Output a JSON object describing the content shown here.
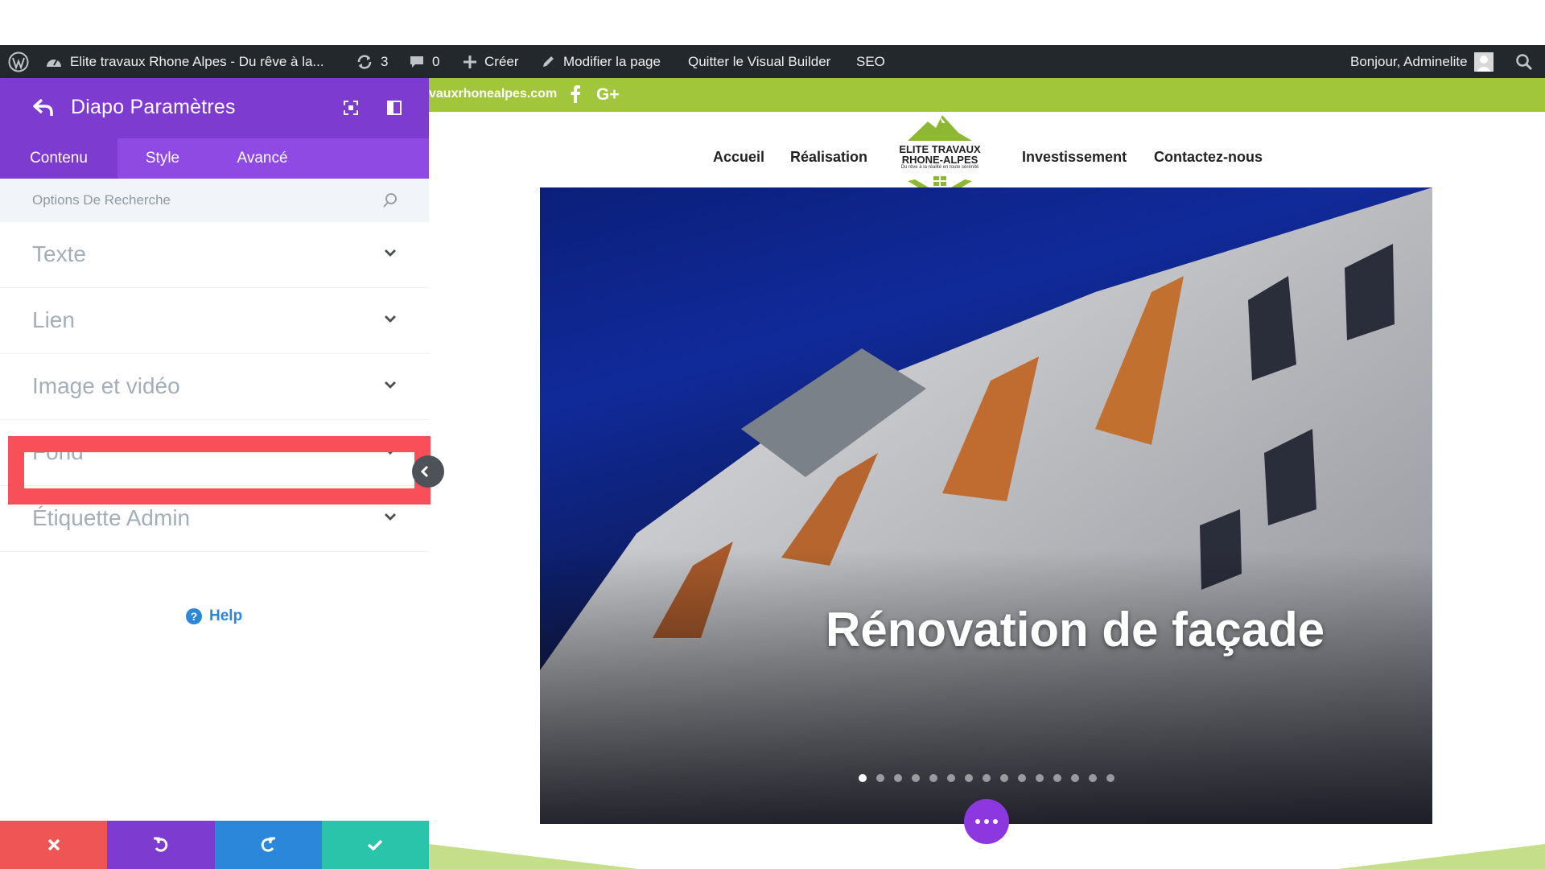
{
  "admin_bar": {
    "site_name": "Elite travaux Rhone Alpes - Du rêve à la...",
    "updates_count": "3",
    "comments_count": "0",
    "create_label": "Créer",
    "edit_page_label": "Modifier la page",
    "exit_builder_label": "Quitter le Visual Builder",
    "seo_label": "SEO",
    "greeting": "Bonjour, Adminelite"
  },
  "panel": {
    "title": "Diapo Paramètres",
    "tabs": [
      {
        "label": "Contenu",
        "active": true
      },
      {
        "label": "Style",
        "active": false
      },
      {
        "label": "Avancé",
        "active": false
      }
    ],
    "search_placeholder": "Options De Recherche",
    "toggles": [
      {
        "label": "Texte"
      },
      {
        "label": "Lien"
      },
      {
        "label": "Image et vidéo"
      },
      {
        "label": "Fond",
        "highlighted": true
      },
      {
        "label": "Étiquette Admin"
      }
    ],
    "help_label": "Help"
  },
  "site": {
    "top_url": "vauxrhonealpes.com",
    "nav": [
      "Accueil",
      "Réalisation",
      "Investissement",
      "Contactez-nous"
    ],
    "logo_line1": "ELITE TRAVAUX",
    "logo_line2": "RHONE-ALPES",
    "logo_tagline": "Du rêve à la réalité en toute sérénité",
    "slide_title": "Rénovation de façade",
    "slide_count": 15,
    "active_slide": 1
  },
  "colors": {
    "purple": "#7d3bcf",
    "highlight": "#f94f59",
    "green": "#a1c63c"
  }
}
